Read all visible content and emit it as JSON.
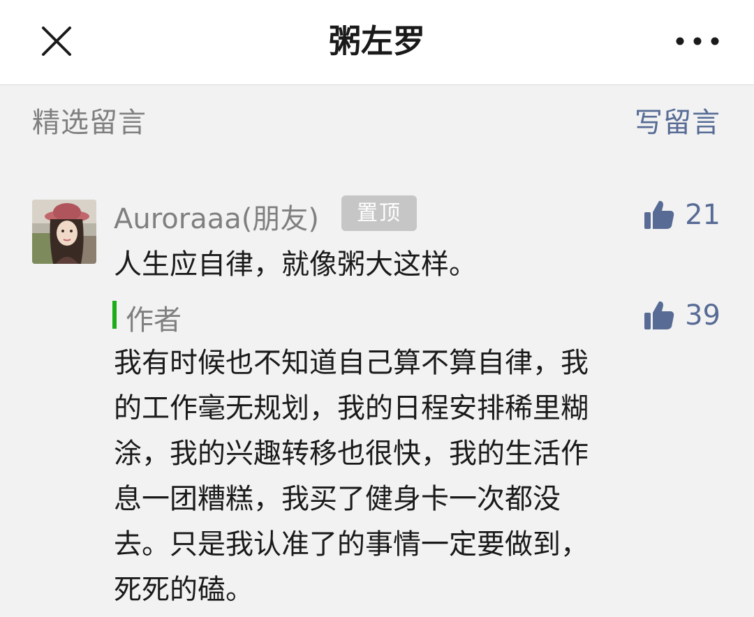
{
  "header": {
    "title": "粥左罗",
    "close_icon": "close-icon",
    "more_icon": "more-icon"
  },
  "section": {
    "title": "精选留言",
    "write_label": "写留言"
  },
  "comment": {
    "nickname": "Auroraaa(朋友)",
    "pinned_label": "置顶",
    "likes": "21",
    "text": "人生应自律，就像粥大这样。"
  },
  "reply": {
    "label": "作者",
    "likes": "39",
    "lines": [
      "我有时候也不知道自己算不算自律，我",
      "的工作毫无规划，我的日程安排稀里糊",
      "涂，我的兴趣转移也很快，我的生活作",
      "息一团糟糕，我买了健身卡一次都没",
      "去。只是我认准了的事情一定要做到，",
      "死死的磕。"
    ]
  },
  "colors": {
    "link": "#576b95",
    "author_bar": "#1aad19",
    "muted_text": "#7f7f7f",
    "badge_bg": "#c6c6c6"
  }
}
